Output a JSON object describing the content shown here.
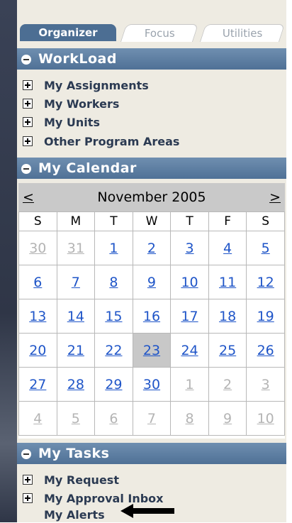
{
  "tabs": [
    {
      "label": "Organizer",
      "active": true
    },
    {
      "label": "Focus",
      "active": false
    },
    {
      "label": "Utilities",
      "active": false
    }
  ],
  "workload": {
    "title": "WorkLoad",
    "items": [
      "My Assignments",
      "My Workers",
      "My Units",
      "Other Program Areas"
    ]
  },
  "calendar_section": {
    "title": "My Calendar",
    "prev": "<",
    "next": ">",
    "month": "November 2005",
    "weekdays": [
      "S",
      "M",
      "T",
      "W",
      "T",
      "F",
      "S"
    ],
    "weeks": [
      [
        "30",
        "31",
        "1",
        "2",
        "3",
        "4",
        "5"
      ],
      [
        "6",
        "7",
        "8",
        "9",
        "10",
        "11",
        "12"
      ],
      [
        "13",
        "14",
        "15",
        "16",
        "17",
        "18",
        "19"
      ],
      [
        "20",
        "21",
        "22",
        "23",
        "24",
        "25",
        "26"
      ],
      [
        "27",
        "28",
        "29",
        "30",
        "1",
        "2",
        "3"
      ],
      [
        "4",
        "5",
        "6",
        "7",
        "8",
        "9",
        "10"
      ]
    ],
    "selected_day": "23"
  },
  "tasks": {
    "title": "My Tasks",
    "items": [
      "My Request",
      "My Approval Inbox"
    ],
    "leaf_item": "My Alerts"
  },
  "colors": {
    "header_blue": "#4f7196",
    "link_blue": "#1f55c8",
    "other_month_grey": "#b4b4b4",
    "panel_bg": "#eeebe2"
  }
}
